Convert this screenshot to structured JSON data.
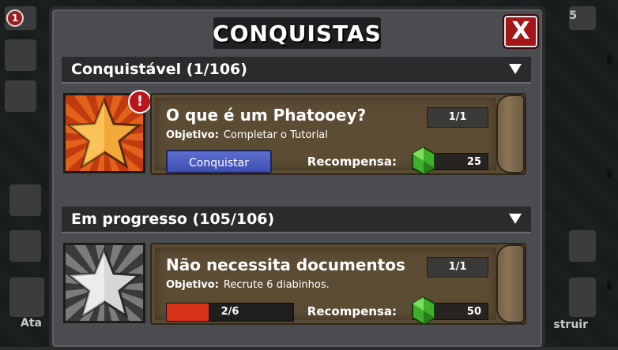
{
  "panel": {
    "title": "CONQUISTAS",
    "close_label": "X"
  },
  "hud": {
    "left_badge": "1",
    "left_label": "Ata",
    "right_badge": "5",
    "right_label": "struir"
  },
  "sections": [
    {
      "label": "Conquistável (1/106)",
      "achievement": {
        "title": "O que é um Phatooey?",
        "objective_label": "Objetivo:",
        "objective": "Completar o Tutorial",
        "count": "1/1",
        "action_label": "Conquistar",
        "reward_label": "Recompensa:",
        "reward": "25",
        "alert": "!"
      }
    },
    {
      "label": "Em progresso (105/106)",
      "achievement": {
        "title": "Não necessita documentos",
        "objective_label": "Objetivo:",
        "objective": "Recrute 6 diabinhos.",
        "count": "1/1",
        "progress_text": "2/6",
        "progress_fraction": 0.333,
        "reward_label": "Recompensa:",
        "reward": "50"
      }
    }
  ],
  "colors": {
    "close": "#a4161a",
    "claim_button": "#4a5cc4",
    "progress_fill": "#d8321b",
    "gem": "#3fae2a"
  }
}
